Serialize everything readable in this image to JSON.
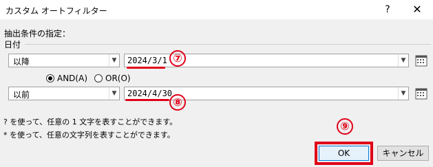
{
  "window": {
    "title": "カスタム オートフィルター",
    "help": "?",
    "close": "✕"
  },
  "section_label": "抽出条件の指定：",
  "group_label": "日付",
  "criteria1": {
    "operator": "以降",
    "value": "2024/3/1"
  },
  "logic": {
    "and_label": "AND(A)",
    "or_label": "OR(O)",
    "selected": "AND"
  },
  "criteria2": {
    "operator": "以前",
    "value": "2024/4/30"
  },
  "hints": [
    "? を使って、任意の 1 文字を表すことができます。",
    "* を使って、任意の文字列を表すことができます。"
  ],
  "buttons": {
    "ok": "OK",
    "cancel": "キャンセル"
  },
  "annotations": {
    "marker7": "⑦",
    "marker8": "⑧",
    "marker9": "⑨",
    "highlight_color": "#e00018"
  },
  "icons": {
    "dropdown": "chevron-down-icon",
    "calendar": "calendar-icon"
  }
}
